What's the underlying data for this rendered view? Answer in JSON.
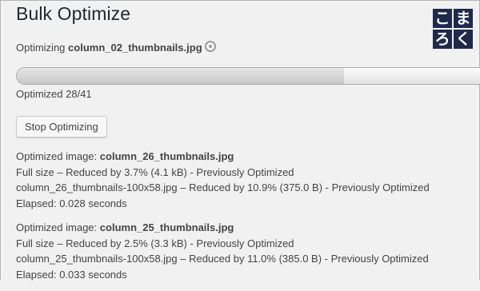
{
  "header": {
    "title": "Bulk Optimize",
    "logo_chars": [
      "こ",
      "ま",
      "ろ",
      "く"
    ]
  },
  "status": {
    "prefix": "Optimizing",
    "filename": "column_02_thumbnails.jpg",
    "spinner_icon": "spinner-icon"
  },
  "progress": {
    "label": "Optimized 28/41",
    "done": 28,
    "total": 41
  },
  "controls": {
    "stop_label": "Stop Optimizing"
  },
  "log": [
    {
      "prefix": "Optimized image:",
      "filename": "column_26_thumbnails.jpg",
      "full_size": "Full size – Reduced by 3.7% (4.1 kB) - Previously Optimized",
      "thumb": "column_26_thumbnails-100x58.jpg – Reduced by 10.9% (375.0 B) - Previously Optimized",
      "elapsed": "Elapsed: 0.028 seconds"
    },
    {
      "prefix": "Optimized image:",
      "filename": "column_25_thumbnails.jpg",
      "full_size": "Full size – Reduced by 2.5% (3.3 kB) - Previously Optimized",
      "thumb": "column_25_thumbnails-100x58.jpg – Reduced by 11.0% (385.0 B) - Previously Optimized",
      "elapsed": "Elapsed: 0.033 seconds"
    }
  ],
  "colors": {
    "logo_bg": "#1d2a4d",
    "page_bg": "#f1f1f1",
    "text": "#444444"
  }
}
